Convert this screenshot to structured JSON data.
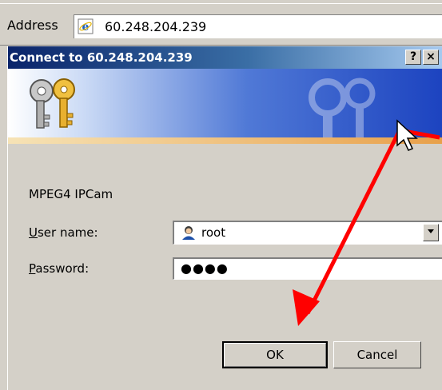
{
  "address_bar": {
    "label": "Address",
    "url": "60.248.204.239",
    "icon": "ie-page-icon"
  },
  "dialog": {
    "title": "Connect to 60.248.204.239",
    "help_button": "?",
    "close_button": "×",
    "realm": "MPEG4 IPCam",
    "user_label": "User name:",
    "user_label_access": "U",
    "user_label_rest": "ser name:",
    "user_value": "root",
    "password_label_access": "P",
    "password_label_rest": "assword:",
    "password_value": "●●●●",
    "ok_label": "OK",
    "cancel_label": "Cancel"
  },
  "annotation": {
    "arrow_color": "#ff0000"
  }
}
